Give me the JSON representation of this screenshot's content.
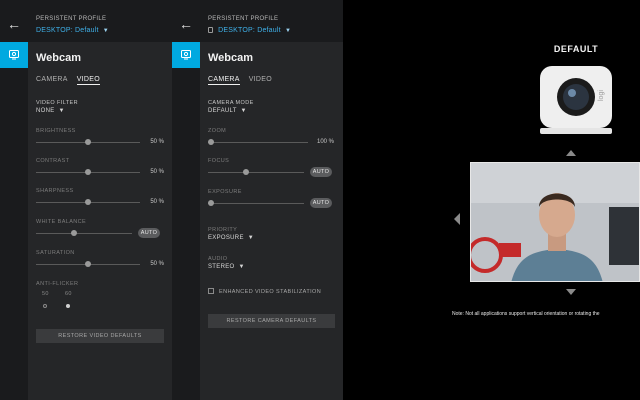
{
  "header": {
    "title": "PERSISTENT PROFILE",
    "profile_prefix": "DESKTOP:",
    "profile_value": "Default"
  },
  "panel": {
    "title": "Webcam"
  },
  "tabs": {
    "camera": "CAMERA",
    "video": "VIDEO"
  },
  "video": {
    "filter_label": "VIDEO FILTER",
    "filter_value": "NONE",
    "brightness": {
      "label": "BRIGHTNESS",
      "value": "50 %",
      "level": 0.5
    },
    "contrast": {
      "label": "CONTRAST",
      "value": "50 %",
      "level": 0.5
    },
    "sharpness": {
      "label": "SHARPNESS",
      "value": "50 %",
      "level": 0.5
    },
    "white_balance": {
      "label": "WHITE BALANCE",
      "mode": "AUTO",
      "level": 0.4
    },
    "saturation": {
      "label": "SATURATION",
      "value": "50 %",
      "level": 0.5
    },
    "anti_flicker": {
      "label": "ANTI-FLICKER",
      "opt1": "50",
      "opt2": "60",
      "selected": "60"
    },
    "restore": "RESTORE VIDEO DEFAULTS"
  },
  "camera": {
    "mode_label": "CAMERA MODE",
    "mode_value": "DEFAULT",
    "zoom": {
      "label": "ZOOM",
      "value": "100 %",
      "level": 0.0
    },
    "focus": {
      "label": "FOCUS",
      "mode": "AUTO",
      "level": 0.4
    },
    "exposure": {
      "label": "EXPOSURE",
      "mode": "AUTO",
      "level": 0.0
    },
    "priority_label": "PRIORITY",
    "priority_value": "EXPOSURE",
    "audio_label": "AUDIO",
    "audio_value": "STEREO",
    "stabilization": "ENHANCED VIDEO STABILIZATION",
    "restore": "RESTORE CAMERA DEFAULTS"
  },
  "preview": {
    "title": "DEFAULT",
    "brand": "logi",
    "note": "Note: Not all applications support vertical orientation or rotating the"
  },
  "colors": {
    "accent": "#00a9e0",
    "panel": "#252628",
    "header": "#1a1b1d"
  }
}
